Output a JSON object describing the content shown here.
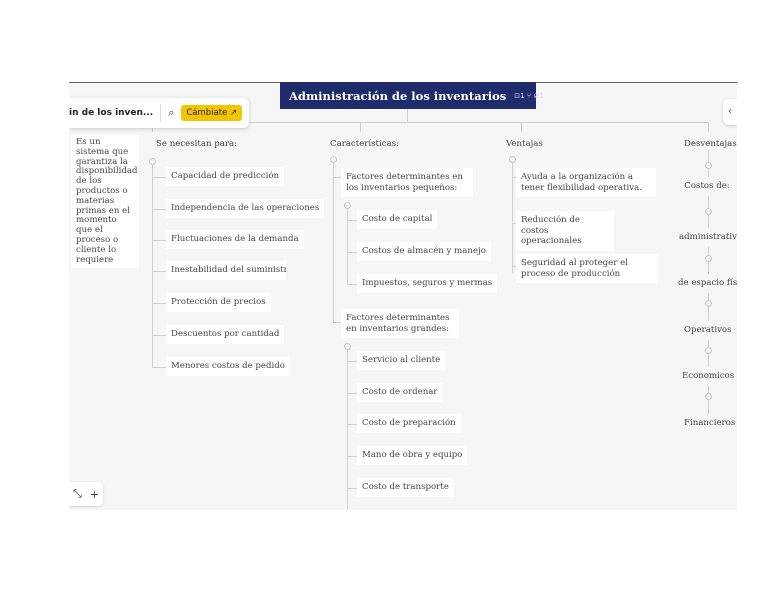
{
  "root": {
    "title": "Administración de los inventarios",
    "comments": "1",
    "tasks": "1"
  },
  "toolbar": {
    "breadcrumb": "in de los inven...",
    "search_icon": "search-icon",
    "cta_label": "Cámbiate ↗"
  },
  "definition": "Es un sistema que garantiza la disponibilidad de los productos o materias primas en el momento que el proceso o cliente lo requiere",
  "needs": {
    "title": "Se necesitan para:",
    "items": [
      "Capacidad de predicción",
      "Independencia de las operaciones",
      "Fluctuaciones de la demanda",
      "Inestabilidad del suministro",
      "Protección de precios",
      "Descuentos por cantidad",
      "Menores costos de pedido"
    ]
  },
  "characteristics": {
    "title": "Características:",
    "small": {
      "title": "Factores determinantes en los inventarios pequeños:",
      "items": [
        "Costo de capital",
        "Costos de almacén y manejo",
        "Impuestos, seguros y mermas"
      ]
    },
    "large": {
      "title": "Factores determinantes en inventarios grandes:",
      "items": [
        "Servicio al cliente",
        "Costo de ordenar",
        "Costo de preparación",
        "Mano de obra y equipo",
        "Costo de transporte"
      ]
    }
  },
  "advantages": {
    "title": "Ventajas",
    "items": [
      "Ayuda a la organización a tener flexibilidad operativa.",
      "Reducción de costos operacionales",
      "Seguridad al proteger el proceso de producción"
    ]
  },
  "disadvantages": {
    "title": "Desventajas",
    "costs_label": "Costos de:",
    "items": [
      "administrativos",
      "de espacio físico",
      "Operativos",
      "Economicos",
      "Financieros"
    ]
  },
  "controls": {
    "zoom_icon": "fit-icon",
    "add_label": "+"
  }
}
